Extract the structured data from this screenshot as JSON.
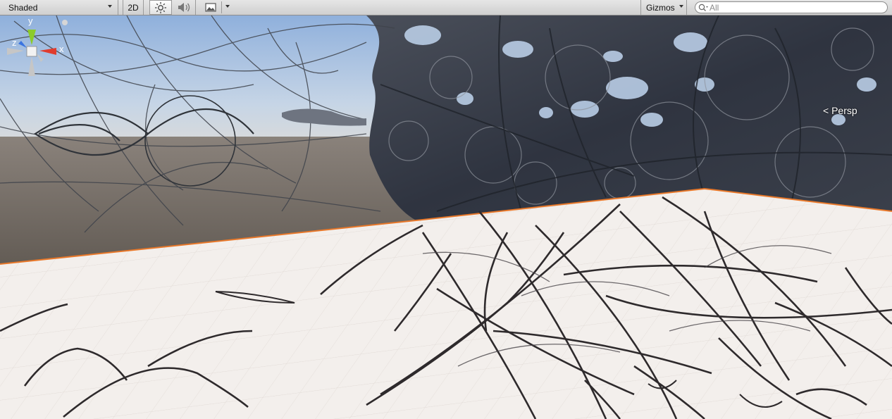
{
  "toolbar": {
    "draw_mode": "Shaded",
    "mode_2d_label": "2D",
    "lighting_icon": "sun-icon",
    "audio_icon": "speaker-icon",
    "effects_icon": "image-icon",
    "gizmos_label": "Gizmos",
    "search_placeholder": "All"
  },
  "scene_gizmo": {
    "axis_y": "y",
    "axis_x": "x",
    "axis_z": "z",
    "projection_label": "Persp",
    "colors": {
      "x": "#e03c2e",
      "y": "#8ccb2a",
      "z": "#3a74e0"
    }
  },
  "scene": {
    "sky_color": "#a9c4e6",
    "ground_color": "#6e6760",
    "plane_color": "#f3efec",
    "plane_edge_color": "#e8782a",
    "fractal_color": "#3c414c"
  }
}
